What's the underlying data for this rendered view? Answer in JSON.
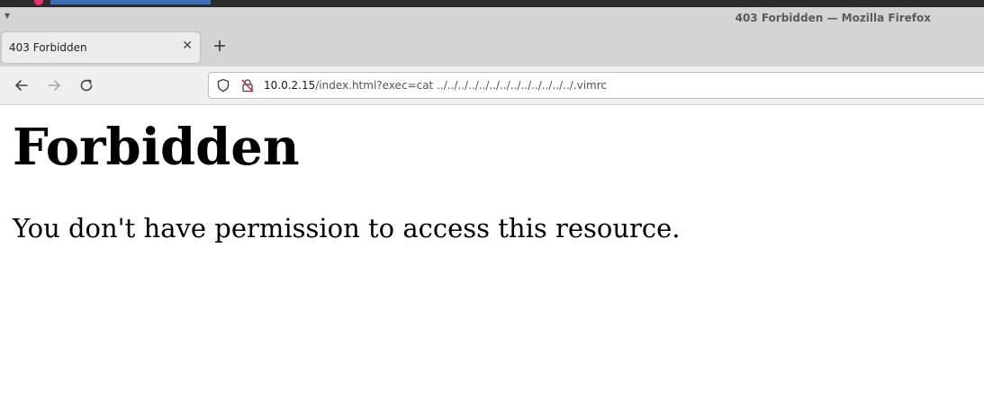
{
  "window": {
    "title": "403 Forbidden — Mozilla Firefox"
  },
  "tabs": [
    {
      "label": "403 Forbidden",
      "active": true
    }
  ],
  "navbar": {
    "url_host": "10.0.2.15",
    "url_path": "/index.html?exec=cat ../../../../../../../../../../../../../.vimrc"
  },
  "page": {
    "heading": "Forbidden",
    "message": "You don't have permission to access this resource."
  },
  "colors": {
    "accent": "#3d6fb5",
    "app_icon": "#e8306a",
    "lock_warning": "#d7264b"
  },
  "icons": {
    "back": "arrow-left-icon",
    "forward": "arrow-right-icon",
    "reload": "reload-icon",
    "shield": "shield-icon",
    "insecure_lock": "insecure-lock-icon",
    "close_tab": "close-icon",
    "new_tab": "plus-icon"
  }
}
